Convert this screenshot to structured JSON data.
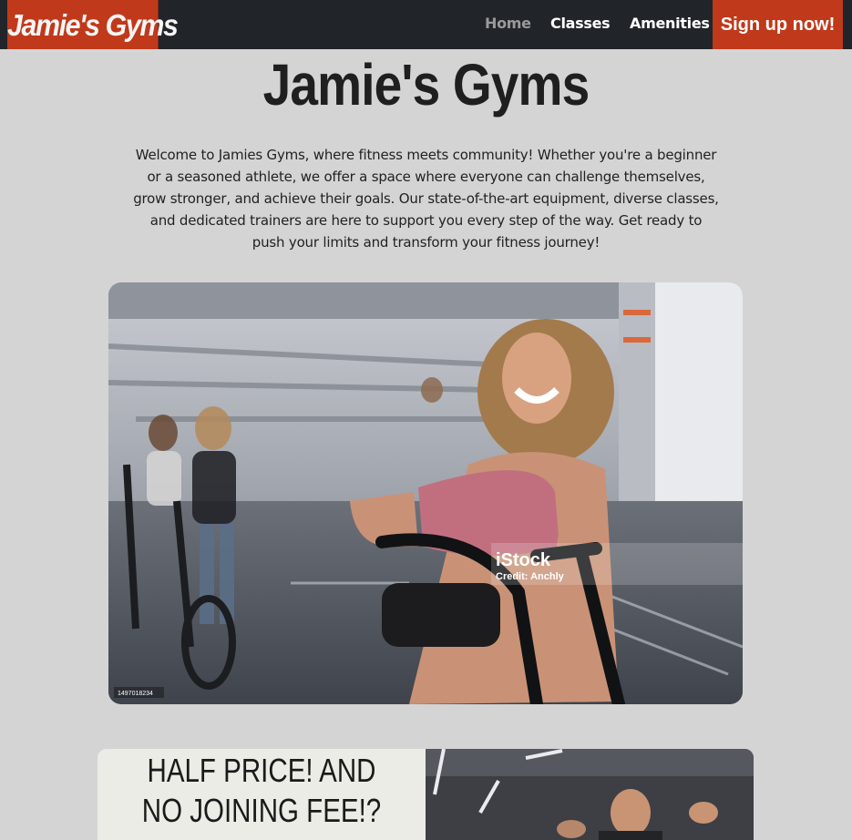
{
  "nav": {
    "brand": "Jamie's Gyms",
    "links": [
      "Home",
      "Classes",
      "Amenities"
    ],
    "active": "Home",
    "signup_label": "Sign up now!"
  },
  "hero": {
    "title": "Jamie's Gyms",
    "intro": "Welcome to Jamies Gyms, where fitness meets community! Whether you're a beginner or a seasoned athlete, we offer a space where everyone can challenge themselves, grow stronger, and achieve their goals. Our state-of-the-art equipment, diverse classes, and dedicated trainers are here to support you every step of the way. Get ready to push your limits and transform your fitness journey!",
    "image": {
      "watermark": "iStock",
      "credit": "Credit: Anchly",
      "stock_id": "1497018234"
    }
  },
  "promo": {
    "headline": "HALF PRICE! AND NO JOINING FEE!?"
  },
  "colors": {
    "brand": "#c0391b",
    "nav_bg": "#212529",
    "page_bg": "#d4d4d4"
  }
}
